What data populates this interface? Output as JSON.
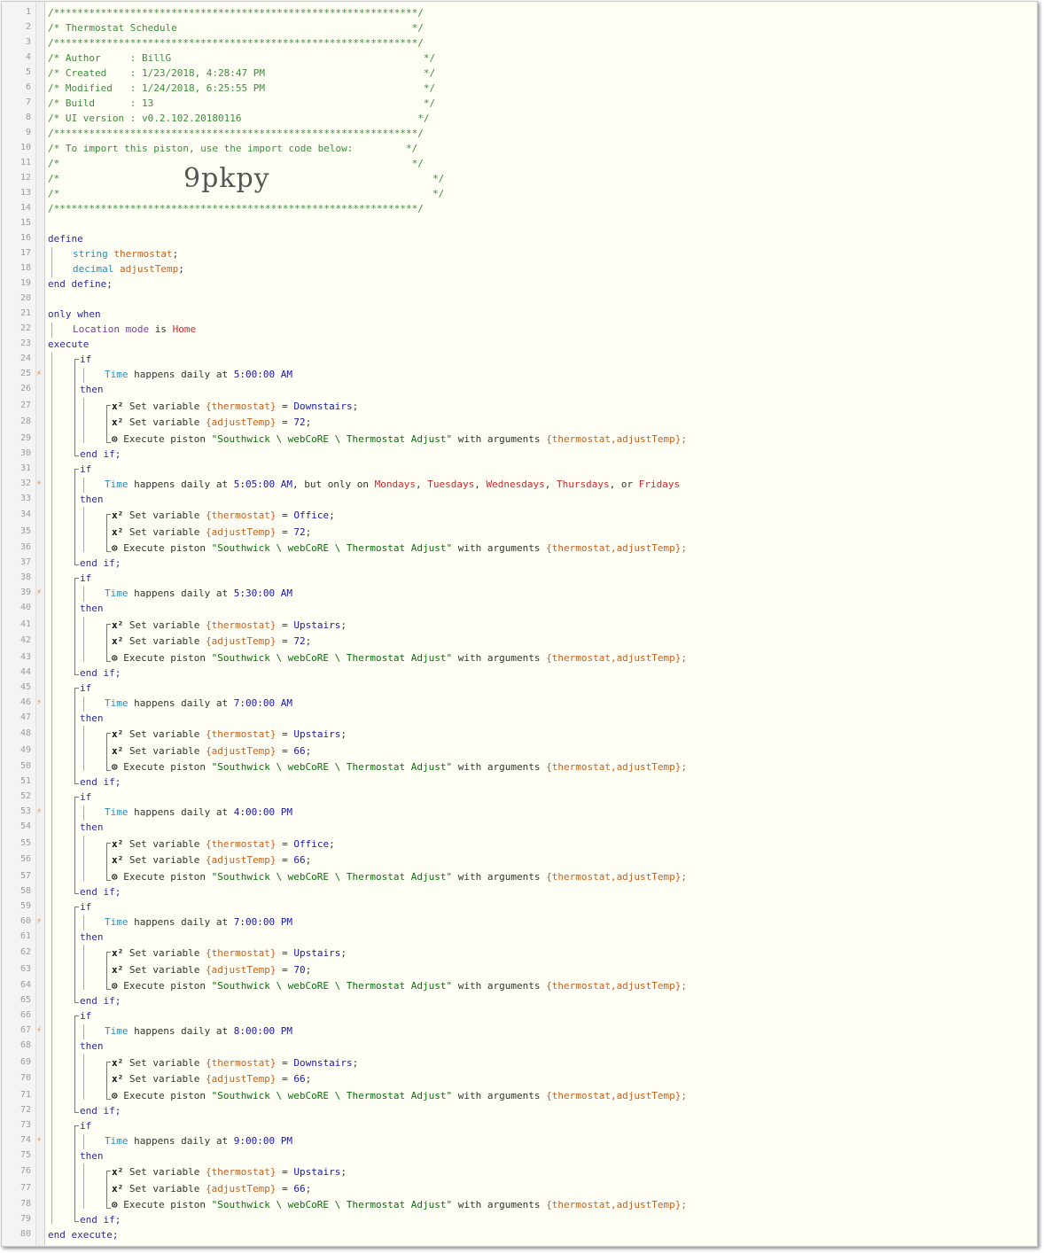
{
  "header": {
    "border_line": "/**************************************************************/",
    "title": "/* Thermostat Schedule                                        */",
    "author": "/* Author     : BillG                                           */",
    "created": "/* Created    : 1/23/2018, 4:28:47 PM                           */",
    "modified": "/* Modified   : 1/24/2018, 6:25:55 PM                           */",
    "build": "/* Build      : 13                                              */",
    "ui_version": "/* UI version : v0.2.102.20180116                              */",
    "import_note": "/* To import this piston, use the import code below:         */",
    "blank_comment": "/*                                                            */",
    "import_code": "9pkpy",
    "comment_open": "/*",
    "comment_close": "*/"
  },
  "define": {
    "keyword": "define",
    "vars": [
      {
        "type": "string",
        "name": "thermostat"
      },
      {
        "type": "decimal",
        "name": "adjustTemp"
      }
    ],
    "end": "end define;"
  },
  "only_when": {
    "keyword": "only when",
    "device": "Location mode",
    "op": "is",
    "value": "Home"
  },
  "execute": {
    "keyword": "execute",
    "end": "end execute;"
  },
  "blocks": [
    {
      "time": "5:00:00 AM",
      "thermostat": "Downstairs",
      "temp": "72"
    },
    {
      "time": "5:05:00 AM",
      "thermostat": "Office",
      "temp": "72",
      "restriction": {
        "text": ", but only on",
        "days": [
          "Mondays",
          "Tuesdays",
          "Wednesdays",
          "Thursdays",
          "Fridays"
        ]
      }
    },
    {
      "time": "5:30:00 AM",
      "thermostat": "Upstairs",
      "temp": "72"
    },
    {
      "time": "7:00:00 AM",
      "thermostat": "Upstairs",
      "temp": "66"
    },
    {
      "time": "4:00:00 PM",
      "thermostat": "Office",
      "temp": "66"
    },
    {
      "time": "7:00:00 PM",
      "thermostat": "Upstairs",
      "temp": "70"
    },
    {
      "time": "8:00:00 PM",
      "thermostat": "Downstairs",
      "temp": "66"
    },
    {
      "time": "9:00:00 PM",
      "thermostat": "Upstairs",
      "temp": "66"
    }
  ],
  "strings": {
    "if": "if",
    "then": "then",
    "end_if": "end if;",
    "time_word": "Time",
    "happens_daily_at": "happens daily at",
    "set_variable": "Set variable",
    "execute_piston": "Execute piston",
    "piston_name": "\"Southwick \\ webCoRE \\ Thermostat Adjust\"",
    "with_arguments": "with arguments",
    "args": "{thermostat,adjustTemp};",
    "var_thermostat": "{thermostat}",
    "var_adjust": "{adjustTemp}",
    "eq": "=",
    "var_icon": "x²",
    "clock_icon": "⊙",
    "trigger_icon": "⚡",
    "or_word": "or"
  },
  "colors": {
    "comment": "#3b8e3b",
    "keyword": "#2b2b9b",
    "type": "#2b8bb6",
    "variable": "#c4621f",
    "device": "#7a3e9d",
    "value": "#1a1aaa",
    "trigger": "#f5822a"
  }
}
